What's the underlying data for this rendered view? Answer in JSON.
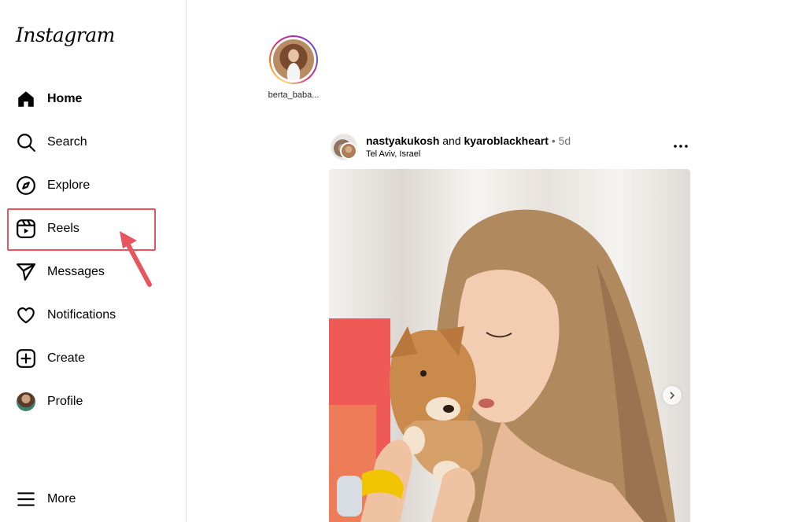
{
  "app": {
    "logo_text": "Instagram"
  },
  "sidebar": {
    "items": [
      {
        "label": "Home",
        "icon": "home-icon",
        "active": true
      },
      {
        "label": "Search",
        "icon": "search-icon"
      },
      {
        "label": "Explore",
        "icon": "compass-icon"
      },
      {
        "label": "Reels",
        "icon": "reels-icon",
        "highlighted": true
      },
      {
        "label": "Messages",
        "icon": "send-icon"
      },
      {
        "label": "Notifications",
        "icon": "heart-icon"
      },
      {
        "label": "Create",
        "icon": "plus-square-icon"
      },
      {
        "label": "Profile",
        "icon": "avatar"
      }
    ],
    "more": {
      "label": "More",
      "icon": "menu-icon"
    }
  },
  "stories": [
    {
      "username": "berta_baba..."
    }
  ],
  "post": {
    "user1": "nastyakukosh",
    "joiner": "and",
    "user2": "kyaroblackheart",
    "separator": "•",
    "time": "5d",
    "location": "Tel Aviv, Israel"
  },
  "colors": {
    "annotation": "#e8555e",
    "story_ring": "#d62976",
    "border": "#dbdbdb",
    "muted_text": "#737373"
  }
}
